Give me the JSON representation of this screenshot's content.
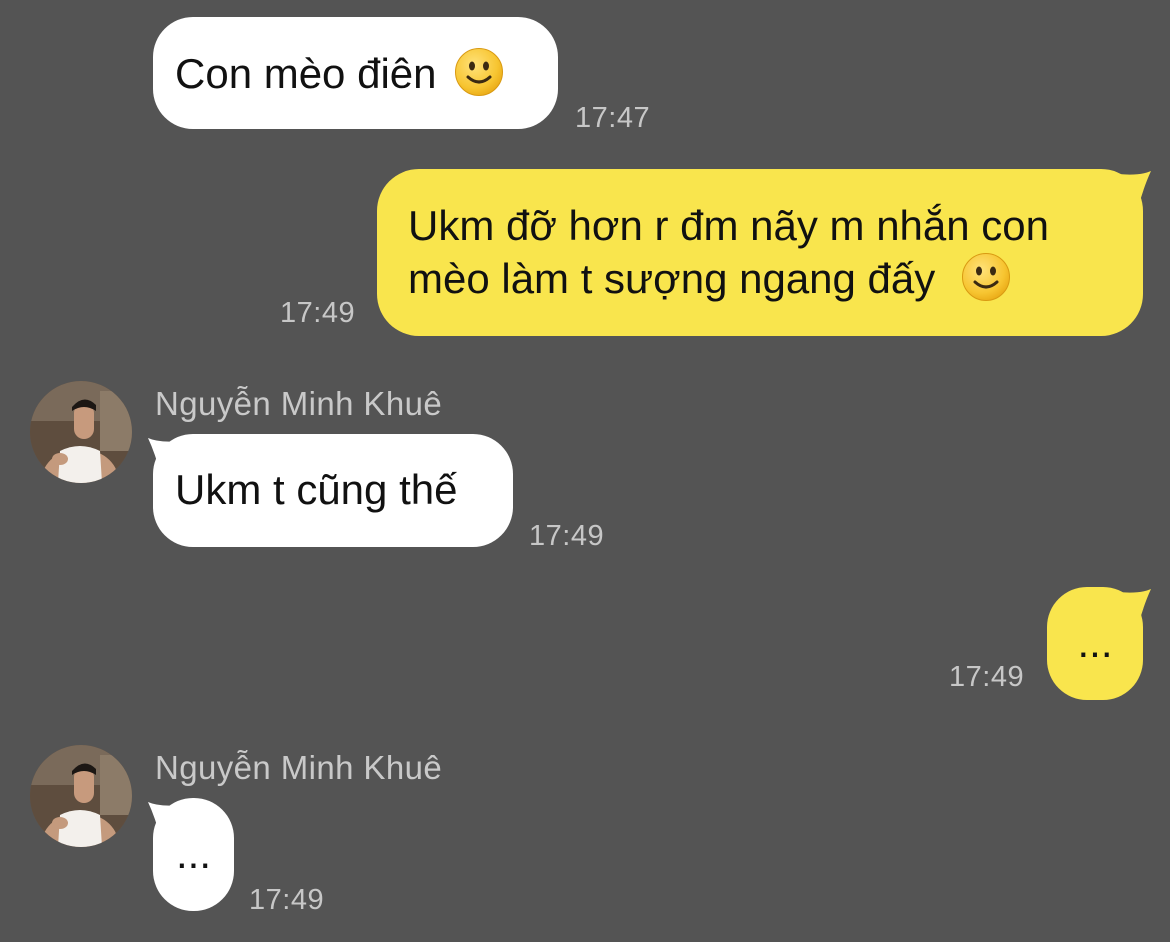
{
  "messages": [
    {
      "id": "m1",
      "side": "incoming",
      "text": "Con mèo điên",
      "emoji": "slightly-smiling-face",
      "time": "17:47"
    },
    {
      "id": "m2",
      "side": "outgoing",
      "line1": "Ukm đỡ hơn r đm nãy m nhắn con",
      "line2": "mèo làm t sượng ngang đấy",
      "emoji": "slightly-smiling-face",
      "time": "17:49"
    },
    {
      "id": "m3",
      "side": "incoming",
      "sender": "Nguyễn Minh Khuê",
      "text": "Ukm t cũng thế",
      "time": "17:49"
    },
    {
      "id": "m4",
      "side": "outgoing",
      "text": "...",
      "time": "17:49"
    },
    {
      "id": "m5",
      "side": "incoming",
      "sender": "Nguyễn Minh Khuê",
      "text": "...",
      "time": "17:49"
    }
  ],
  "colors": {
    "background": "#545454",
    "incoming_bubble": "#ffffff",
    "outgoing_bubble": "#f9e54d",
    "timestamp": "#c7c7c7",
    "sender_name": "#c9c9c9"
  }
}
